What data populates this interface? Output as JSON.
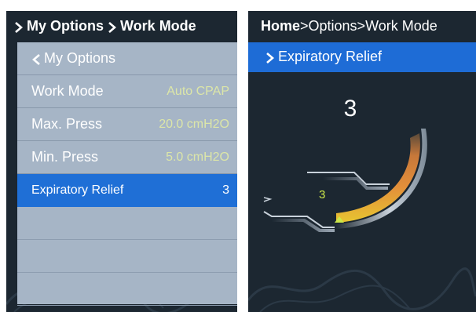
{
  "left_panel": {
    "breadcrumb": [
      {
        "label": "My Options"
      },
      {
        "label": "Work Mode"
      }
    ],
    "menu": [
      {
        "label": "My Options",
        "value": "",
        "type": "back"
      },
      {
        "label": "Work Mode",
        "value": "Auto CPAP"
      },
      {
        "label": "Max. Press",
        "value": "20.0 cmH2O"
      },
      {
        "label": "Min. Press",
        "value": "5.0 cmH2O"
      },
      {
        "label": "Expiratory Relief",
        "value": "3",
        "selected": true
      }
    ]
  },
  "right_panel": {
    "breadcrumb": {
      "home": "Home",
      "rest": ">Options>Work Mode"
    },
    "sub_title": "Expiratory Relief",
    "relief_value": "3",
    "relief_small_value": "3",
    "gauge_level": 3,
    "gauge_max": 3
  },
  "colors": {
    "screen_bg": "#1c2731",
    "menu_bg": "#a6b5c6",
    "selection": "#1f6fd6",
    "value_text": "#dce6a8",
    "gauge_orange": "#e38f3a",
    "gauge_yellow": "#e7c531",
    "indicator_green": "#cde84a"
  }
}
